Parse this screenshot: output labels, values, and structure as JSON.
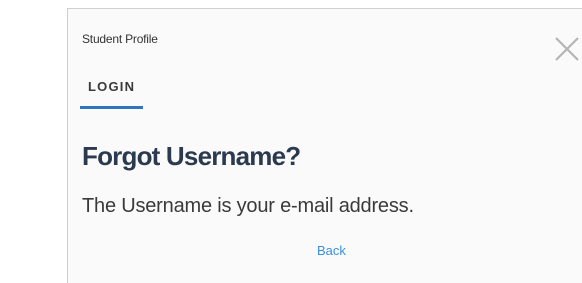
{
  "dialog": {
    "title": "Student Profile",
    "close_icon": "close-icon"
  },
  "tabs": [
    {
      "label": "LOGIN",
      "active": true
    }
  ],
  "content": {
    "heading": "Forgot Username?",
    "message": "The Username is your e-mail address.",
    "back_link": "Back"
  },
  "colors": {
    "accent": "#2f74c0",
    "heading": "#2b3a4e",
    "link": "#3a8fd8",
    "background": "#fafafa"
  }
}
